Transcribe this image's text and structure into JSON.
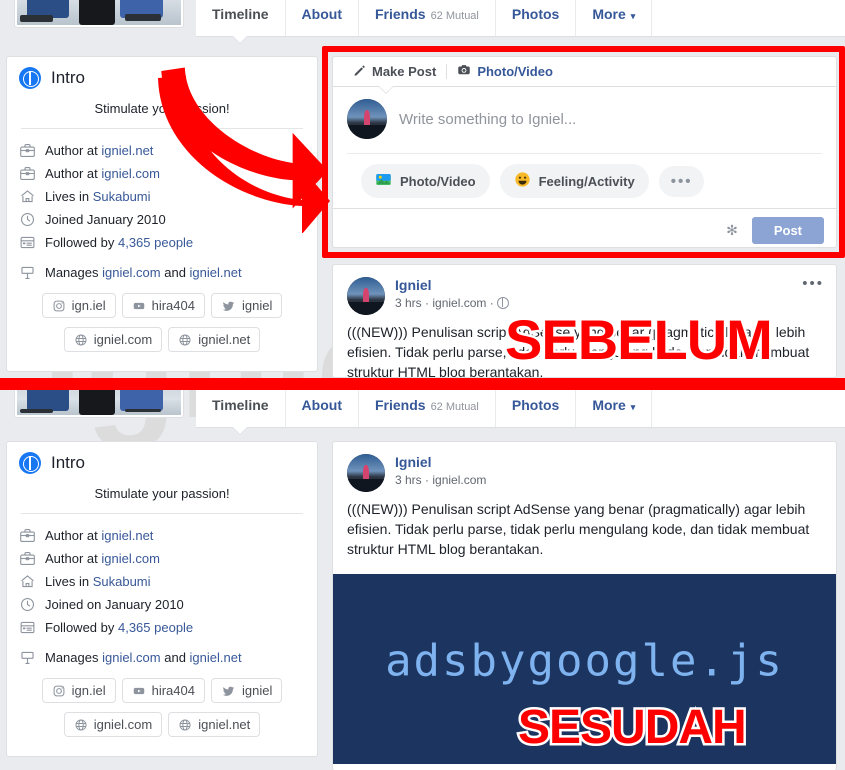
{
  "annotations": {
    "before_label": "SEBELUM",
    "after_label": "SESUDAH",
    "watermark": "igniel.com",
    "accent_red": "#fe0000"
  },
  "tabs": [
    {
      "label": "Timeline",
      "sub": "",
      "active": true
    },
    {
      "label": "About",
      "sub": "",
      "active": false
    },
    {
      "label": "Friends",
      "sub": "62 Mutual",
      "active": false
    },
    {
      "label": "Photos",
      "sub": "",
      "active": false
    },
    {
      "label": "More",
      "sub": "",
      "active": false,
      "caret": "▾"
    }
  ],
  "intro_top": {
    "title": "Intro",
    "bio": "Stimulate your passion!",
    "rows": [
      {
        "icon": "briefcase-icon",
        "prefix": "Author at ",
        "link": "igniel.net",
        "suffix": ""
      },
      {
        "icon": "briefcase-icon",
        "prefix": "Author at ",
        "link": "igniel.com",
        "suffix": ""
      },
      {
        "icon": "home-icon",
        "prefix": "Lives in ",
        "link": "Sukabumi",
        "suffix": ""
      },
      {
        "icon": "clock-icon",
        "prefix": "Joined January 2010",
        "link": "",
        "suffix": ""
      },
      {
        "icon": "feed-icon",
        "prefix": "Followed by ",
        "link": "4,365 people",
        "suffix": ""
      },
      {
        "icon": "page-icon",
        "prefix": "Manages ",
        "link": "igniel.com",
        "suffix": " and ",
        "link2": "igniel.net"
      }
    ],
    "chips": [
      {
        "icon": "instagram-icon",
        "label": "ign.iel"
      },
      {
        "icon": "youtube-icon",
        "label": "hira404"
      },
      {
        "icon": "twitter-icon",
        "label": "igniel"
      },
      {
        "icon": "globe-icon",
        "label": "igniel.com"
      },
      {
        "icon": "globe-icon",
        "label": "igniel.net"
      }
    ]
  },
  "intro_bottom": {
    "title": "Intro",
    "bio": "Stimulate your passion!",
    "rows": [
      {
        "icon": "briefcase-icon",
        "prefix": "Author at ",
        "link": "igniel.net",
        "suffix": ""
      },
      {
        "icon": "briefcase-icon",
        "prefix": "Author at ",
        "link": "igniel.com",
        "suffix": ""
      },
      {
        "icon": "home-icon",
        "prefix": "Lives in ",
        "link": "Sukabumi",
        "suffix": ""
      },
      {
        "icon": "clock-icon",
        "prefix": "Joined on January 2010",
        "link": "",
        "suffix": ""
      },
      {
        "icon": "feed-icon",
        "prefix": "Followed by ",
        "link": "4,365 people",
        "suffix": ""
      },
      {
        "icon": "page-icon",
        "prefix": "Manages ",
        "link": "igniel.com",
        "suffix": " and ",
        "link2": "igniel.net"
      }
    ],
    "chips": [
      {
        "icon": "instagram-icon",
        "label": "ign.iel"
      },
      {
        "icon": "youtube-icon",
        "label": "hira404"
      },
      {
        "icon": "twitter-icon",
        "label": "igniel"
      },
      {
        "icon": "globe-icon",
        "label": "igniel.com"
      },
      {
        "icon": "globe-icon",
        "label": "igniel.net"
      }
    ]
  },
  "composer": {
    "tab_make_post": "Make Post",
    "tab_photo_video": "Photo/Video",
    "placeholder": "Write something to Igniel...",
    "action_photo_video": "Photo/Video",
    "action_feeling": "Feeling/Activity",
    "action_more": "•••",
    "gear": "✻",
    "post_button": "Post"
  },
  "post_top": {
    "author": "Igniel",
    "time": "3 hrs",
    "source": "igniel.com",
    "menu": "•••",
    "text": "(((NEW))) Penulisan script AdSense yang benar (pragmatically) agar lebih efisien. Tidak perlu parse, tidak perlu mengulang kode, dan tidak membuat struktur HTML blog berantakan."
  },
  "post_bottom": {
    "author": "Igniel",
    "time": "3 hrs",
    "source": "igniel.com",
    "text": "(((NEW))) Penulisan script AdSense yang benar (pragmatically) agar lebih efisien. Tidak perlu parse, tidak perlu mengulang kode, dan tidak membuat struktur HTML blog berantakan.",
    "image_code": "adsbygoogle.js",
    "image_bg": "#1c3460",
    "image_code_color": "#7fb3ef"
  }
}
